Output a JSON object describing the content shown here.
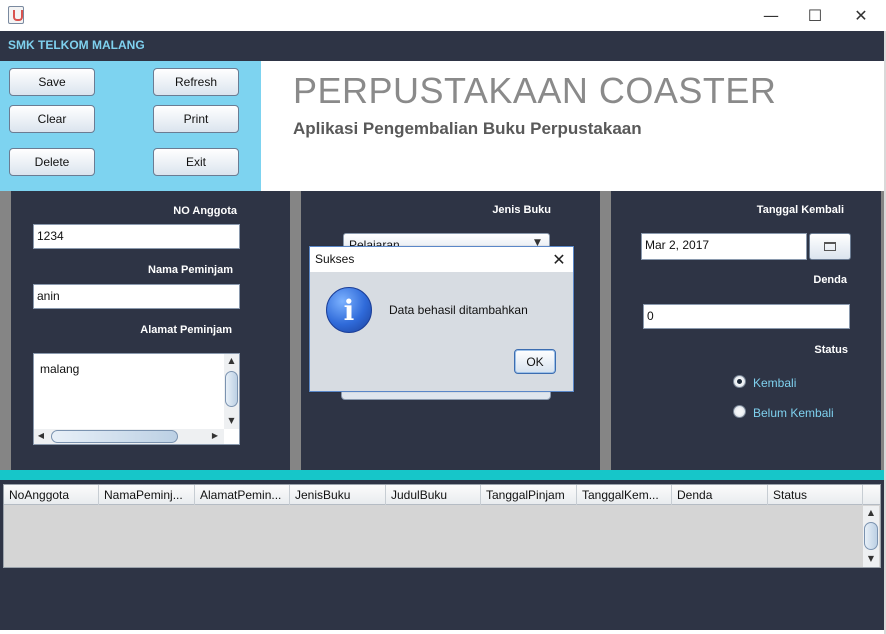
{
  "window": {
    "icon": "java-cup-icon",
    "controls": {
      "minimize": "—",
      "maximize": "☐",
      "close": "✕"
    }
  },
  "header": {
    "school": "SMK TELKOM MALANG"
  },
  "buttons": {
    "save": "Save",
    "refresh": "Refresh",
    "clear": "Clear",
    "print": "Print",
    "delete": "Delete",
    "exit": "Exit"
  },
  "title": {
    "main": "PERPUSTAKAAN COASTER",
    "sub": "Aplikasi Pengembalian Buku Perpustakaan"
  },
  "form": {
    "no_anggota": {
      "label": "NO Anggota",
      "value": "1234"
    },
    "nama_peminjam": {
      "label": "Nama Peminjam",
      "value": "anin"
    },
    "alamat_peminjam": {
      "label": "Alamat Peminjam",
      "value": "malang"
    },
    "jenis_buku": {
      "label": "Jenis Buku",
      "value": "Pelajaran"
    },
    "tanggal_kembali": {
      "label": "Tanggal Kembali",
      "value": "Mar 2, 2017"
    },
    "denda": {
      "label": "Denda",
      "value": "0"
    },
    "status": {
      "label": "Status",
      "options": [
        "Kembali",
        "Belum Kembali"
      ],
      "selected": "Kembali"
    }
  },
  "table": {
    "columns": [
      "NoAnggota",
      "NamaPeminj...",
      "AlamatPemin...",
      "JenisBuku",
      "JudulBuku",
      "TanggalPinjam",
      "TanggalKem...",
      "Denda",
      "Status"
    ],
    "rows": []
  },
  "dialog": {
    "title": "Sukses",
    "icon": "info-icon",
    "message": "Data behasil ditambahkan",
    "ok_label": "OK",
    "close_glyph": "✕"
  },
  "colors": {
    "dark_panel": "#2e3445",
    "accent_blue": "#7dd3f0",
    "teal_bar": "#16c6c9",
    "title_gray": "#8a8a8a"
  }
}
